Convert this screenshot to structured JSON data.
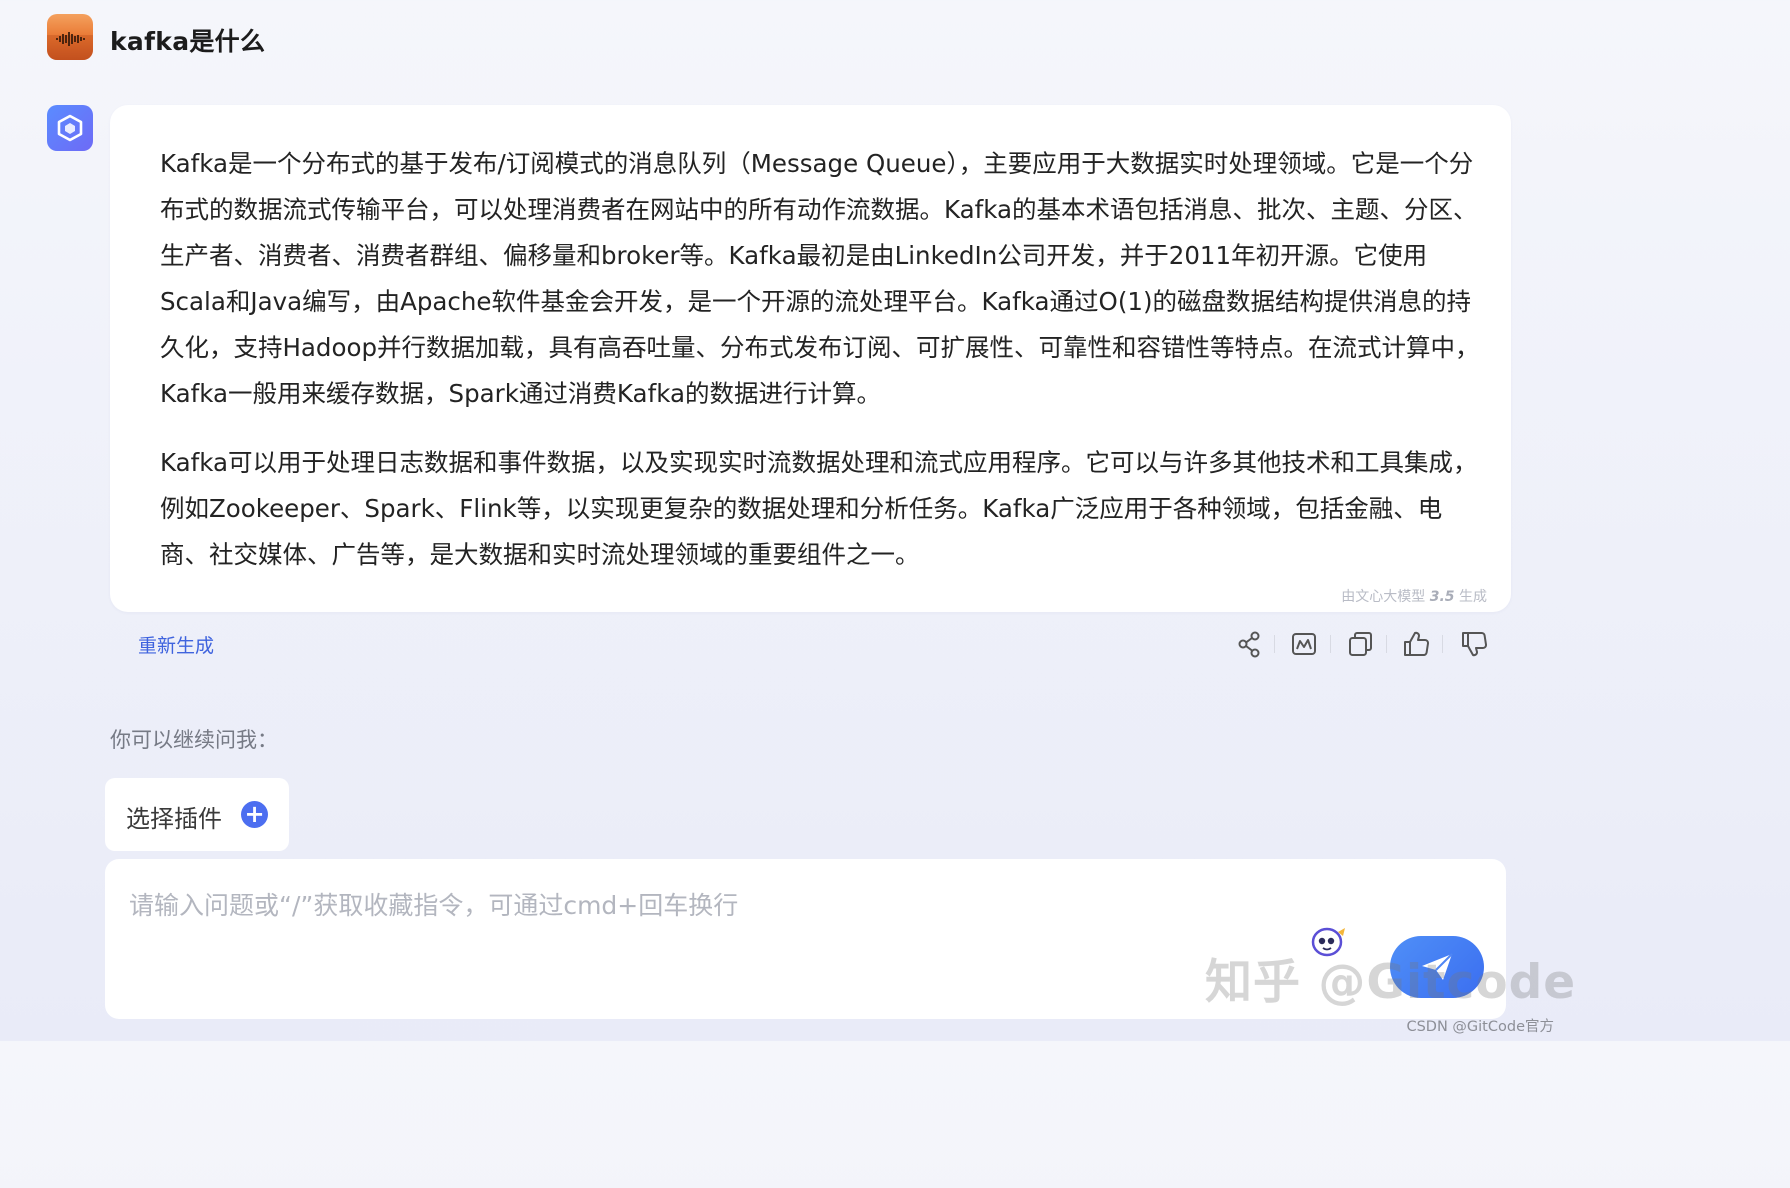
{
  "question": "kafka是什么",
  "answer": {
    "paragraphs": [
      "Kafka是一个分布式的基于发布/订阅模式的消息队列（Message Queue），主要应用于大数据实时处理领域。它是一个分布式的数据流式传输平台，可以处理消费者在网站中的所有动作流数据。Kafka的基本术语包括消息、批次、主题、分区、生产者、消费者、消费者群组、偏移量和broker等。Kafka最初是由LinkedIn公司开发，并于2011年初开源。它使用Scala和Java编写，由Apache软件基金会开发，是一个开源的流处理平台。Kafka通过O(1)的磁盘数据结构提供消息的持久化，支持Hadoop并行数据加载，具有高吞吐量、分布式发布订阅、可扩展性、可靠性和容错性等特点。在流式计算中，Kafka一般用来缓存数据，Spark通过消费Kafka的数据进行计算。",
      "Kafka可以用于处理日志数据和事件数据，以及实现实时流数据处理和流式应用程序。它可以与许多其他技术和工具集成，例如Zookeeper、Spark、Flink等，以实现更复杂的数据处理和分析任务。Kafka广泛应用于各种领域，包括金融、电商、社交媒体、广告等，是大数据和实时流处理领域的重要组件之一。"
    ],
    "generated_by_prefix": "由文心大模型",
    "generated_by_version": "3.5",
    "generated_by_suffix": "生成"
  },
  "actions": {
    "regenerate_label": "重新生成",
    "icons": [
      "share-icon",
      "image-export-icon",
      "copy-icon",
      "thumbs-up-icon",
      "thumbs-down-icon"
    ]
  },
  "followup": {
    "prompt_label": "你可以继续问我："
  },
  "plugin": {
    "label": "选择插件"
  },
  "input": {
    "placeholder": "请输入问题或“/”获取收藏指令，可通过cmd+回车换行"
  },
  "watermarks": {
    "zhihu": "知乎 @Gitcode",
    "csdn": "CSDN @GitCode官方"
  },
  "colors": {
    "accent": "#3f63de",
    "send_button": "#4c7ff5",
    "plugin_plus": "#4c6ef0"
  }
}
